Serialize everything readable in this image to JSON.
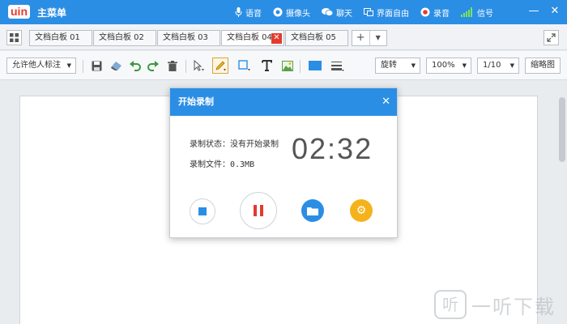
{
  "app": {
    "logo": "uin",
    "title": "主菜单"
  },
  "titlebar": {
    "items": [
      {
        "label": "语音",
        "icon": "microphone-icon"
      },
      {
        "label": "摄像头",
        "icon": "camera-icon"
      },
      {
        "label": "聊天",
        "icon": "chat-icon"
      },
      {
        "label": "界面自由",
        "icon": "window-layout-icon"
      },
      {
        "label": "录音",
        "icon": "record-icon"
      },
      {
        "label": "信号",
        "icon": "signal-icon"
      }
    ]
  },
  "tabs": [
    {
      "label": "文档白板 01",
      "active": false
    },
    {
      "label": "文档白板 02",
      "active": false
    },
    {
      "label": "文档白板 03",
      "active": false
    },
    {
      "label": "文档白板 04",
      "active": true
    },
    {
      "label": "文档白板 05",
      "active": false
    }
  ],
  "toolbar": {
    "permission": "允许他人标注",
    "rotate": "旋转",
    "zoom": "100%",
    "page": "1/10",
    "thumbnail": "缩略图"
  },
  "dialog": {
    "title": "开始录制",
    "status_label": "录制状态：",
    "status_value": "没有开始录制",
    "file_label": "录制文件：",
    "file_size": "0.3MB",
    "timer": "02:32"
  },
  "watermark": {
    "text": "一听下载"
  },
  "colors": {
    "accent": "#2b8ee5",
    "danger": "#e53a2f",
    "warning": "#f5b21b"
  }
}
